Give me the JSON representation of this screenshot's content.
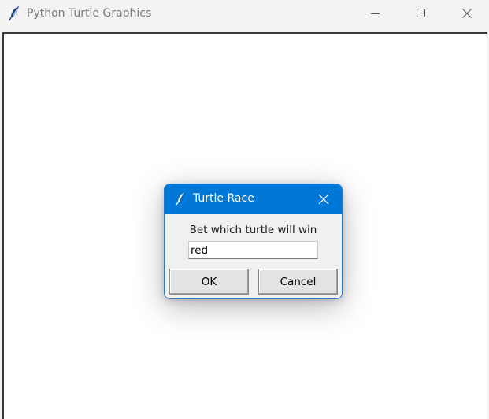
{
  "window": {
    "title": "Python Turtle Graphics",
    "icon": "feather-icon",
    "controls": [
      "minimize-icon",
      "maximize-icon",
      "close-icon"
    ]
  },
  "dialog": {
    "title": "Turtle Race",
    "icon": "feather-icon",
    "prompt": "Bet which turtle will win",
    "input_value": "red",
    "ok_label": "OK",
    "cancel_label": "Cancel"
  },
  "colors": {
    "dialog_titlebar": "#0078d7",
    "window_titlebar": "#f3f3f3",
    "canvas": "#ffffff"
  }
}
